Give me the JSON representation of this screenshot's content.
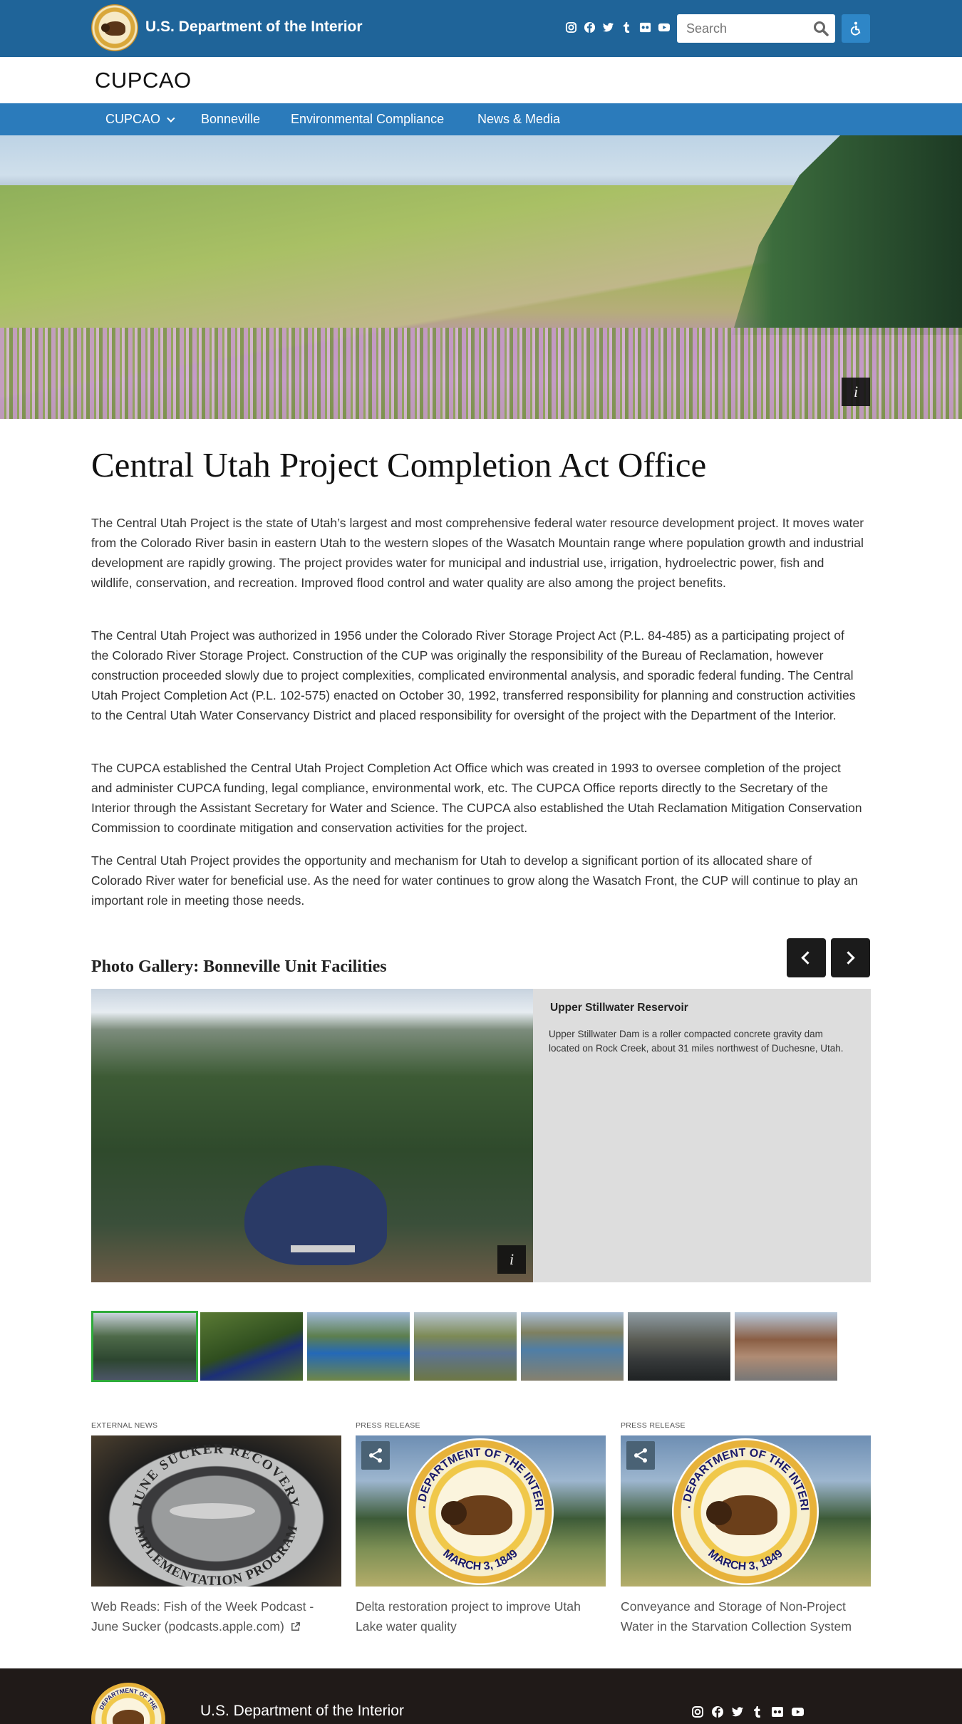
{
  "header": {
    "agency_name": "U.S. Department of the Interior",
    "social_icons": [
      "instagram-icon",
      "facebook-icon",
      "twitter-icon",
      "tumblr-icon",
      "flickr-icon",
      "youtube-icon"
    ],
    "search": {
      "placeholder": "Search"
    },
    "accessibility_icon": "accessibility-icon"
  },
  "site": {
    "title": "CUPCAO"
  },
  "nav": {
    "items": [
      {
        "label": "CUPCAO",
        "has_dropdown": true
      },
      {
        "label": "Bonneville"
      },
      {
        "label": "Environmental Compliance"
      },
      {
        "label": "News & Media"
      }
    ]
  },
  "hero": {
    "info_label": "i"
  },
  "main": {
    "title": "Central Utah Project Completion Act Office",
    "paragraphs": [
      "The Central Utah Project is the state of Utah’s largest and most comprehensive federal water resource development project. It moves water from the Colorado River basin in eastern Utah to the western slopes of the Wasatch Mountain range where population growth and industrial development are rapidly growing. The project provides water for municipal and industrial use, irrigation, hydroelectric power, fish and wildlife, conservation, and recreation. Improved flood control and water quality are also among the project benefits.",
      "The Central Utah Project was authorized in 1956 under the Colorado River Storage Project Act (P.L. 84-485) as a participating project of the Colorado River Storage Project. Construction of the CUP was originally the responsibility of the Bureau of Reclamation, however construction proceeded slowly due to project complexities, complicated environmental analysis, and sporadic federal funding. The Central Utah Project Completion Act (P.L. 102-575) enacted on October 30, 1992, transferred responsibility for planning and construction activities to the Central Utah Water Conservancy District and placed responsibility for oversight of the project with the Department of the Interior.",
      "The CUPCA established the Central Utah Project Completion Act Office which was created in 1993 to oversee completion of the project and administer CUPCA funding, legal compliance, environmental work, etc. The CUPCA Office reports directly to the Secretary of the Interior through the Assistant Secretary for Water and Science. The CUPCA also established the Utah Reclamation Mitigation Conservation Commission to coordinate mitigation and conservation activities for the project.",
      "The Central Utah Project provides the opportunity and mechanism for Utah to develop a significant portion of its allocated share of Colorado River water for beneficial use. As the need for water continues to grow along the Wasatch Front, the CUP will continue to play an important role in meeting those needs."
    ]
  },
  "gallery": {
    "title": "Photo Gallery: Bonneville Unit Facilities",
    "current_slide": {
      "title": "Upper Stillwater Reservoir",
      "description": "Upper Stillwater Dam is a roller compacted concrete gravity dam located on Rock Creek, about 31 miles northwest of Duchesne, Utah.",
      "info_label": "i"
    },
    "thumbnail_count": 7,
    "active_thumbnail": 1
  },
  "news": [
    {
      "kind": "EXTERNAL NEWS",
      "title": "Web Reads: Fish of the Week Podcast - June Sucker (podcasts.apple.com)",
      "external": true,
      "coin_text_top": "JUNE SUCKER RECOVERY",
      "coin_text_bottom": "IMPLEMENTATION PROGRAM"
    },
    {
      "kind": "PRESS RELEASE",
      "title": "Delta restoration project to improve Utah Lake water quality",
      "seal_text_top": "U.S. DEPARTMENT OF THE INTERIOR",
      "seal_text_bottom": "MARCH 3, 1849"
    },
    {
      "kind": "PRESS RELEASE",
      "title": "Conveyance and Storage of Non-Project Water in the Starvation Collection System",
      "seal_text_top": "U.S. DEPARTMENT OF THE INTERIOR",
      "seal_text_bottom": "MARCH 3, 1849"
    }
  ],
  "footer": {
    "agency_name": "U.S. Department of the Interior",
    "seal_text": "DEPARTMENT OF THE"
  }
}
